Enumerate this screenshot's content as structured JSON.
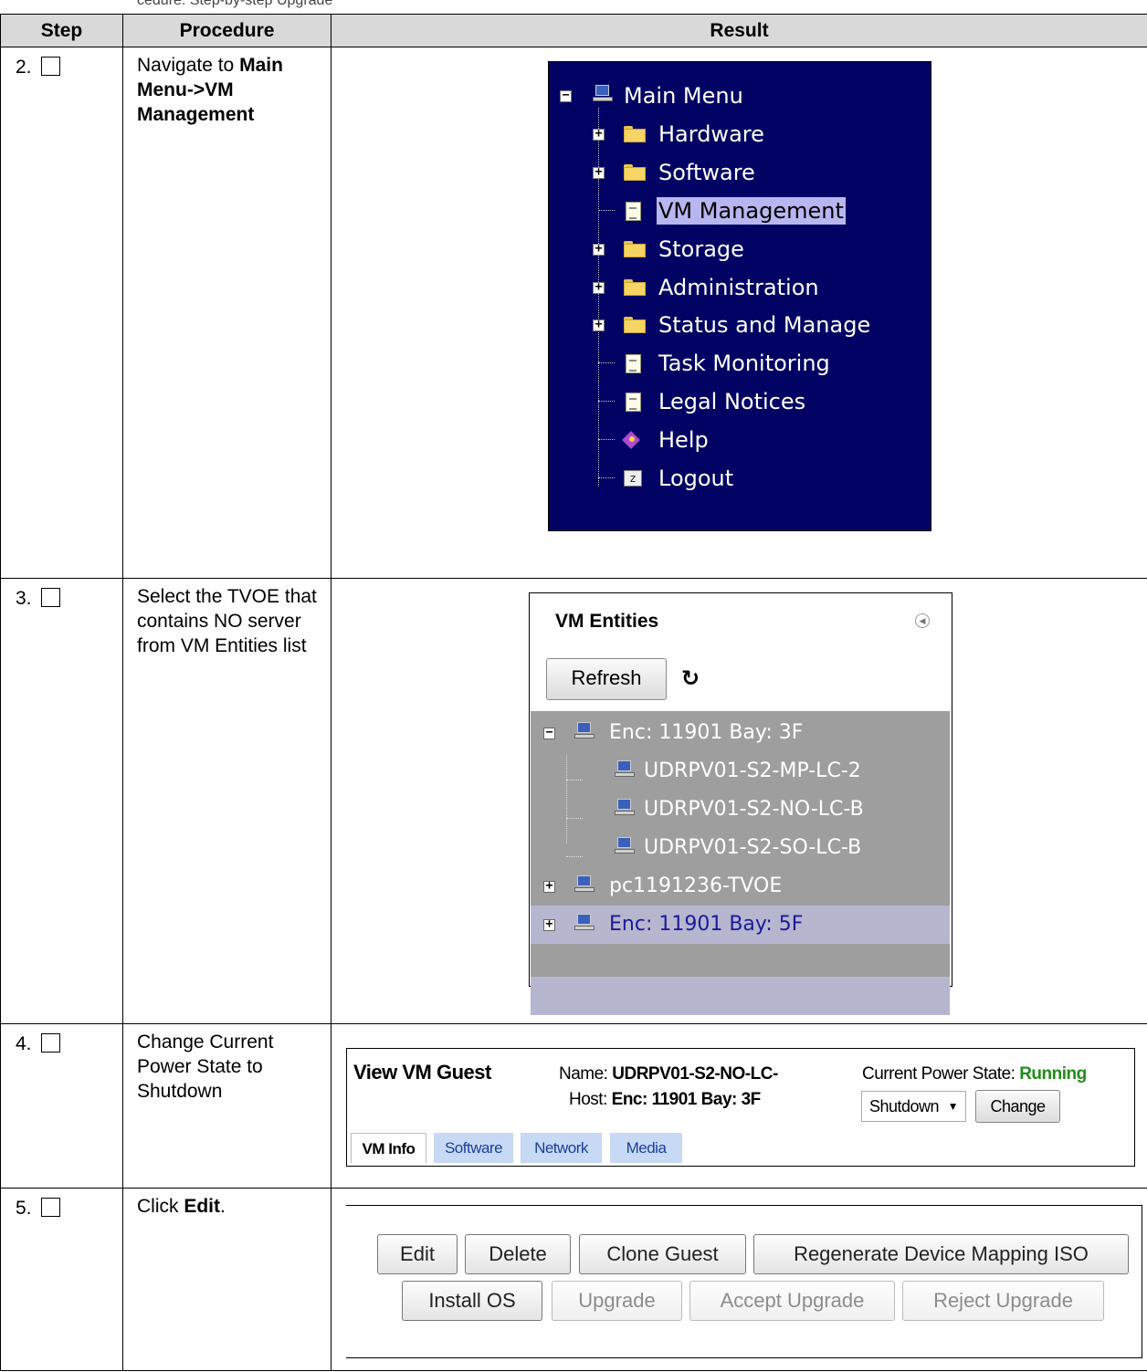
{
  "caption": "cedure: Step-by-step Upgrade",
  "table": {
    "headers": {
      "step": "Step",
      "procedure": "Procedure",
      "result": "Result"
    }
  },
  "steps": [
    {
      "number": "2.",
      "procedure_prefix": "Navigate to ",
      "procedure_bold": "Main Menu->VM Management",
      "procedure_suffix": ""
    },
    {
      "number": "3.",
      "procedure_prefix": "Select the TVOE that contains NO server from VM Entities list",
      "procedure_bold": "",
      "procedure_suffix": ""
    },
    {
      "number": "4.",
      "procedure_prefix": "Change Current Power State to Shutdown",
      "procedure_bold": "",
      "procedure_suffix": ""
    },
    {
      "number": "5.",
      "procedure_prefix": "Click ",
      "procedure_bold": "Edit",
      "procedure_suffix": "."
    }
  ],
  "main_menu": {
    "title": "Main Menu",
    "items": [
      {
        "label": "Hardware",
        "icon": "folder-icon",
        "expandable": true
      },
      {
        "label": "Software",
        "icon": "folder-icon",
        "expandable": true
      },
      {
        "label": "VM Management",
        "icon": "document-icon",
        "expandable": false,
        "selected": true
      },
      {
        "label": "Storage",
        "icon": "folder-icon",
        "expandable": true
      },
      {
        "label": "Administration",
        "icon": "folder-icon",
        "expandable": true
      },
      {
        "label": "Status and Manage",
        "icon": "folder-icon",
        "expandable": true
      },
      {
        "label": "Task Monitoring",
        "icon": "document-icon",
        "expandable": false
      },
      {
        "label": "Legal Notices",
        "icon": "document-icon",
        "expandable": false
      },
      {
        "label": "Help",
        "icon": "help-book-icon",
        "expandable": false
      },
      {
        "label": "Logout",
        "icon": "logout-icon",
        "expandable": false
      }
    ]
  },
  "vm_entities": {
    "title": "VM Entities",
    "refresh_label": "Refresh",
    "tree": [
      {
        "label": "Enc: 11901 Bay: 3F",
        "level": 0,
        "expander": "-"
      },
      {
        "label": "UDRPV01-S2-MP-LC-2",
        "level": 1
      },
      {
        "label": "UDRPV01-S2-NO-LC-B",
        "level": 1
      },
      {
        "label": "UDRPV01-S2-SO-LC-B",
        "level": 1
      },
      {
        "label": "pc1191236-TVOE",
        "level": 0,
        "expander": "+"
      },
      {
        "label": "Enc: 11901 Bay: 5F",
        "level": 0,
        "expander": "+",
        "selected": true
      }
    ]
  },
  "vm_guest": {
    "title": "View VM Guest",
    "name_label": "Name:",
    "name_value": "UDRPV01-S2-NO-LC-",
    "host_label": "Host:",
    "host_value": "Enc: 11901 Bay: 3F",
    "power_state_label": "Current Power State:",
    "power_state_value": "Running",
    "power_state_color": "#1f8d18",
    "select_value": "Shutdown",
    "change_label": "Change",
    "tabs": [
      "VM Info",
      "Software",
      "Network",
      "Media"
    ],
    "active_tab": "VM Info"
  },
  "actions": {
    "row1": [
      "Edit",
      "Delete",
      "Clone Guest",
      "Regenerate Device Mapping ISO"
    ],
    "row2": [
      "Install OS",
      "Upgrade",
      "Accept Upgrade",
      "Reject Upgrade"
    ],
    "disabled": [
      "Upgrade",
      "Accept Upgrade",
      "Reject Upgrade"
    ]
  },
  "colors": {
    "menu_background": "#020265",
    "tree_background": "#9e9e9e",
    "selection": "#b8b6f0",
    "header_background": "#d9d9d9"
  }
}
